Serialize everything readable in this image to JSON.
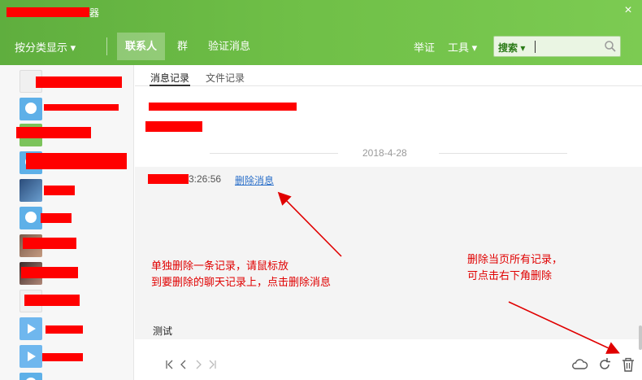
{
  "window": {
    "title": "器",
    "close_label": "×"
  },
  "toolbar": {
    "sort_label": "按分类显示 ▾",
    "tabs": [
      {
        "label": "联系人",
        "active": true
      },
      {
        "label": "群",
        "active": false
      },
      {
        "label": "验证消息",
        "active": false
      }
    ],
    "report_label": "举证",
    "tools_label": "工具 ▾",
    "search_label": "搜索 ▾"
  },
  "subtabs": [
    {
      "label": "消息记录",
      "active": true
    },
    {
      "label": "文件记录",
      "active": false
    }
  ],
  "history": {
    "date": "2018-4-28",
    "message_time": "3:26:56",
    "delete_message_label": "删除消息",
    "message_text": "测试"
  },
  "annotations": {
    "single_delete_line1": "单独删除一条记录，请鼠标放",
    "single_delete_line2": "到要删除的聊天记录上，点击删除消息",
    "delete_all_line1": "删除当页所有记录，",
    "delete_all_line2": "可点击右下角删除"
  },
  "pager": {
    "first_icon": "first-page-icon",
    "prev_icon": "prev-page-icon",
    "next_icon": "next-page-icon",
    "last_icon": "last-page-icon"
  },
  "bottom_icons": [
    "cloud-icon",
    "refresh-icon",
    "trash-icon"
  ],
  "colors": {
    "header_green": "#6fbf47",
    "redaction_red": "#ff0000",
    "link_blue": "#2a6fc9",
    "annotation_red": "#e00000"
  }
}
